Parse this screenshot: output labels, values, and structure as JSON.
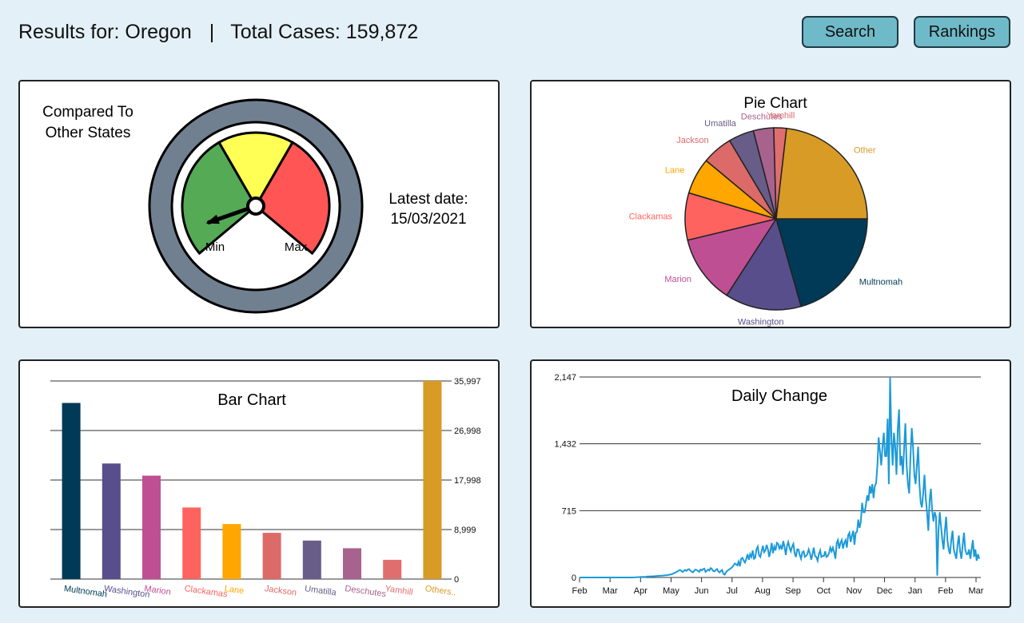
{
  "header": {
    "results_label": "Results for: Oregon",
    "separator": "|",
    "total_label": "Total Cases: 159,872",
    "search_label": "Search",
    "rankings_label": "Rankings"
  },
  "gauge": {
    "compared_line1": "Compared To",
    "compared_line2": "Other States",
    "min_label": "Min",
    "max_label": "Max",
    "latest_line1": "Latest date:",
    "latest_line2": "15/03/2021",
    "needle_level": 0.08,
    "colors": {
      "low": "#55aa55",
      "mid": "#ffff55",
      "high": "#ff5555",
      "ring": "#708090"
    }
  },
  "pie": {
    "title": "Pie Chart",
    "slices": [
      {
        "name": "Multnomah",
        "value": 32000,
        "color": "#003a57"
      },
      {
        "name": "Washington",
        "value": 21000,
        "color": "#584e8b"
      },
      {
        "name": "Marion",
        "value": 18800,
        "color": "#bf4f93"
      },
      {
        "name": "Clackamas",
        "value": 13000,
        "color": "#ff6360"
      },
      {
        "name": "Lane",
        "value": 10000,
        "color": "#ffa600"
      },
      {
        "name": "Jackson",
        "value": 8400,
        "color": "#dc6a68"
      },
      {
        "name": "Umatilla",
        "value": 7000,
        "color": "#675d88"
      },
      {
        "name": "Deschutes",
        "value": 5600,
        "color": "#a8628e"
      },
      {
        "name": "Yamhill",
        "value": 3500,
        "color": "#e06e6e"
      },
      {
        "name": "Other",
        "value": 35997,
        "color": "#d89b26"
      }
    ]
  },
  "chart_data": [
    {
      "type": "bar",
      "title": "Bar Chart",
      "categories": [
        "Multnomah",
        "Washington",
        "Marion",
        "Clackamas",
        "Lane",
        "Jackson",
        "Umatilla",
        "Deschutes",
        "Yamhill",
        "Others.."
      ],
      "values": [
        32000,
        21000,
        18800,
        13000,
        10000,
        8400,
        7000,
        5600,
        3500,
        35997
      ],
      "colors": [
        "#003a57",
        "#584e8b",
        "#bf4f93",
        "#ff6360",
        "#ffa600",
        "#dc6a68",
        "#675d88",
        "#a8628e",
        "#e06e6e",
        "#d89b26"
      ],
      "yticks": [
        "0",
        "8,999",
        "17,998",
        "26,998",
        "35,997"
      ],
      "ylim": [
        0,
        35997
      ]
    },
    {
      "type": "line",
      "title": "Daily Change",
      "xticks": [
        "Feb",
        "Mar",
        "Apr",
        "May",
        "Jun",
        "Jul",
        "Aug",
        "Sep",
        "Oct",
        "Nov",
        "Dec",
        "Jan",
        "Feb",
        "Mar"
      ],
      "yticks": [
        "0",
        "715",
        "1,432",
        "2,147"
      ],
      "ylim": [
        0,
        2147
      ],
      "color": "#1b9ad9",
      "x_start": "2020-02-01",
      "x_end": "2021-03-15",
      "values": [
        0,
        0,
        0,
        0,
        0,
        0,
        0,
        0,
        0,
        0,
        0,
        0,
        0,
        0,
        0,
        0,
        0,
        0,
        0,
        0,
        0,
        0,
        0,
        0,
        0,
        0,
        0,
        0,
        0,
        0,
        0,
        0,
        0,
        0,
        0,
        0,
        0,
        0,
        0,
        0,
        0,
        0,
        0,
        1,
        2,
        3,
        3,
        4,
        5,
        6,
        6,
        7,
        8,
        9,
        10,
        11,
        12,
        12,
        13,
        14,
        15,
        16,
        17,
        18,
        19,
        20,
        21,
        23,
        24,
        26,
        28,
        30,
        34,
        38,
        45,
        50,
        58,
        65,
        75,
        80,
        70,
        58,
        72,
        80,
        70,
        85,
        90,
        75,
        65,
        55,
        70,
        85,
        80,
        70,
        60,
        85,
        75,
        90,
        95,
        60,
        70,
        85,
        75,
        100,
        90,
        70,
        65,
        80,
        90,
        65,
        55,
        70,
        80,
        40,
        30,
        55,
        70,
        80,
        90,
        100,
        110,
        130,
        150,
        140,
        130,
        170,
        120,
        200,
        210,
        180,
        160,
        200,
        250,
        190,
        250,
        220,
        290,
        200,
        210,
        300,
        330,
        240,
        220,
        280,
        340,
        270,
        290,
        350,
        300,
        220,
        290,
        370,
        260,
        330,
        290,
        370,
        360,
        310,
        340,
        300,
        390,
        330,
        240,
        340,
        380,
        320,
        280,
        330,
        360,
        260,
        220,
        300,
        300,
        240,
        200,
        270,
        280,
        220,
        230,
        250,
        300,
        260,
        190,
        250,
        320,
        230,
        220,
        180,
        250,
        290,
        220,
        230,
        230,
        280,
        220,
        230,
        260,
        320,
        280,
        320,
        270,
        200,
        370,
        400,
        310,
        370,
        400,
        310,
        370,
        400,
        320,
        450,
        480,
        380,
        450,
        500,
        350,
        480,
        490,
        620,
        530,
        600,
        800,
        700,
        700,
        780,
        880,
        820,
        980,
        900,
        1000,
        850,
        980,
        1010,
        1200,
        1500,
        1350,
        1200,
        1400,
        1550,
        1300,
        1300,
        1700,
        1000,
        2147,
        1500,
        1200,
        1550,
        1400,
        1100,
        1600,
        1800,
        1200,
        1300,
        1100,
        1400,
        1650,
        1200,
        1000,
        900,
        1300,
        1600,
        1400,
        1100,
        1000,
        1200,
        1400,
        1000,
        800,
        750,
        900,
        1100,
        850,
        700,
        500,
        820,
        950,
        720,
        600,
        700,
        650,
        20,
        500,
        700,
        550,
        400,
        300,
        500,
        650,
        400,
        300,
        250,
        400,
        500,
        300,
        250,
        200,
        350,
        450,
        280,
        200,
        350,
        480,
        300,
        250,
        250,
        300,
        200,
        300,
        400,
        220,
        300,
        180,
        250,
        200
      ]
    }
  ]
}
